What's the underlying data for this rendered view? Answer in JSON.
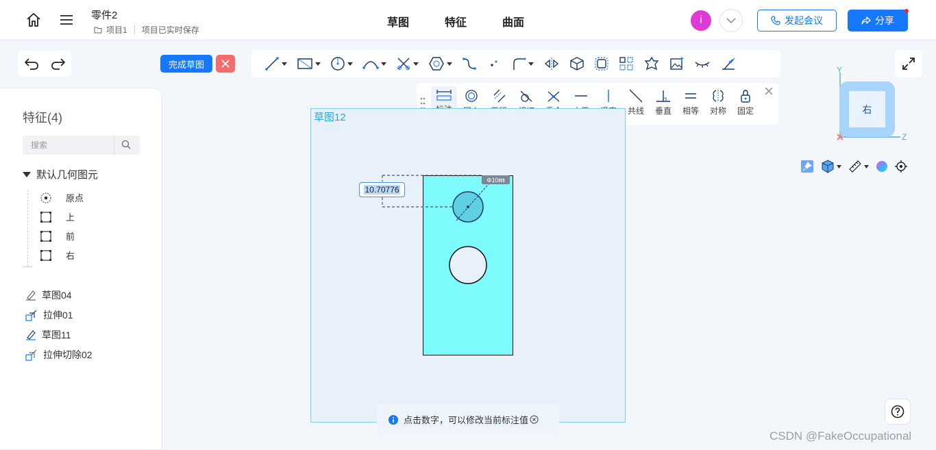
{
  "header": {
    "doc_title": "零件2",
    "project": "项目1",
    "save_status": "项目已实时保存",
    "tabs": [
      "草图",
      "特征",
      "曲面"
    ],
    "avatar_letter": "i",
    "meeting_label": "发起会议",
    "share_label": "分享"
  },
  "toolbar": {
    "finish_label": "完成草图",
    "tools": [
      "line-tool-icon",
      "rectangle-tool-icon",
      "circle-tool-icon",
      "arc-tool-icon",
      "trim-tool-icon",
      "polygon-tool-icon",
      "spline-tool-icon",
      "point-tool-icon",
      "fillet-tool-icon",
      "mirror-tool-icon",
      "project-3d-icon",
      "offset-icon",
      "pattern-icon",
      "shape-library-icon",
      "image-icon",
      "hide-icon",
      "constraint-check-icon"
    ]
  },
  "palette": {
    "items": [
      "标注",
      "同心",
      "平行",
      "相切",
      "重合",
      "水平",
      "竖直",
      "共线",
      "垂直",
      "相等",
      "对称",
      "固定"
    ]
  },
  "sidebar": {
    "title": "特征(4)",
    "search_placeholder": "搜索",
    "group_label": "默认几何图元",
    "geometry": [
      "原点",
      "上",
      "前",
      "右"
    ],
    "features": [
      "草图04",
      "拉伸01",
      "草图11",
      "拉伸切除02"
    ]
  },
  "canvas": {
    "plane_label": "草图12",
    "dimension_value": "10.70776",
    "diameter_tag": "Φ10㎜",
    "hint": "点击数字，可以修改当前标注值"
  },
  "view_cube": {
    "face_label": "右",
    "axis_y": "Y",
    "axis_z": "Z"
  },
  "watermark": "CSDN @FakeOccupational",
  "colors": {
    "accent": "#1677ff",
    "part_fill": "#7dfbfc",
    "cancel": "#f56c6c",
    "avatar": "#e03ad6"
  }
}
